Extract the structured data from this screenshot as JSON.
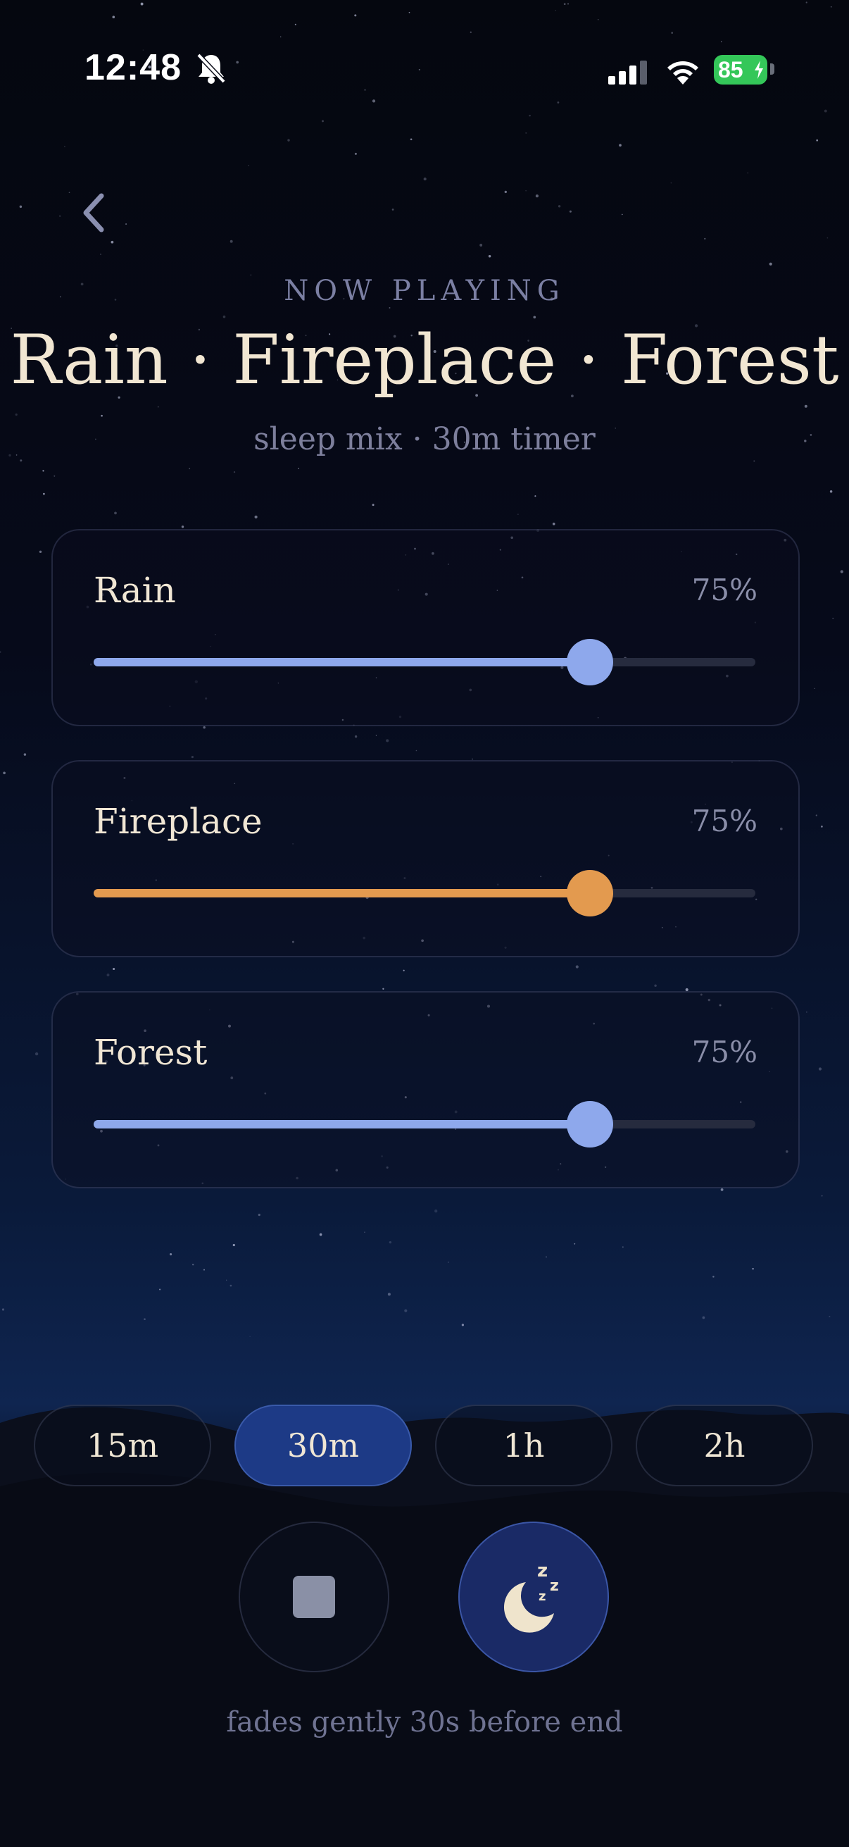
{
  "status": {
    "time": "12:48",
    "battery": "85"
  },
  "header": {
    "eyebrow": "NOW PLAYING",
    "title": "Rain · Fireplace · Forest",
    "subtitle": "sleep mix · 30m timer"
  },
  "sounds": [
    {
      "label": "Rain",
      "percent_text": "75%",
      "volume": 0.75,
      "color": "#8ea8ec"
    },
    {
      "label": "Fireplace",
      "percent_text": "75%",
      "volume": 0.75,
      "color": "#e39a4f"
    },
    {
      "label": "Forest",
      "percent_text": "75%",
      "volume": 0.75,
      "color": "#8ea8ec"
    }
  ],
  "timers": [
    {
      "label": "15m",
      "active": false
    },
    {
      "label": "30m",
      "active": true
    },
    {
      "label": "1h",
      "active": false
    },
    {
      "label": "2h",
      "active": false
    }
  ],
  "controls": {
    "stop_icon": "stop-icon",
    "sleep_icon": "moon-zzz-icon"
  },
  "footer": {
    "note": "fades gently 30s before end"
  },
  "colors": {
    "accent": "#1d3a86",
    "text": "#efe6d4",
    "muted": "#7d7f9c"
  }
}
